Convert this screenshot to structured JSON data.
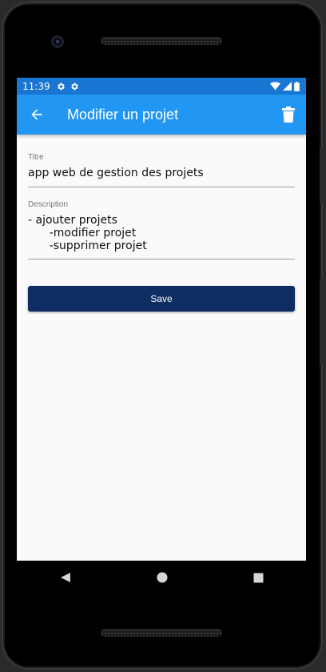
{
  "status_bar": {
    "time": "11:39",
    "left_icons": [
      "gear-icon",
      "gear-icon"
    ],
    "right_icons": [
      "wifi-icon",
      "signal-icon",
      "battery-icon"
    ]
  },
  "app_bar": {
    "title": "Modifier un projet",
    "color": "#2196f3",
    "back_icon": "arrow-back-icon",
    "action_icon": "trash-icon"
  },
  "form": {
    "title_field": {
      "label": "Titre",
      "value": "app web de gestion des projets"
    },
    "description_field": {
      "label": "Description",
      "value": "- ajouter projets\n      -modifier projet\n      -supprimer projet"
    },
    "save_button": {
      "label": "Save",
      "color": "#0d2d63"
    }
  },
  "nav_bar": {
    "icons": [
      "back-triangle-icon",
      "home-circle-icon",
      "recents-square-icon"
    ]
  }
}
